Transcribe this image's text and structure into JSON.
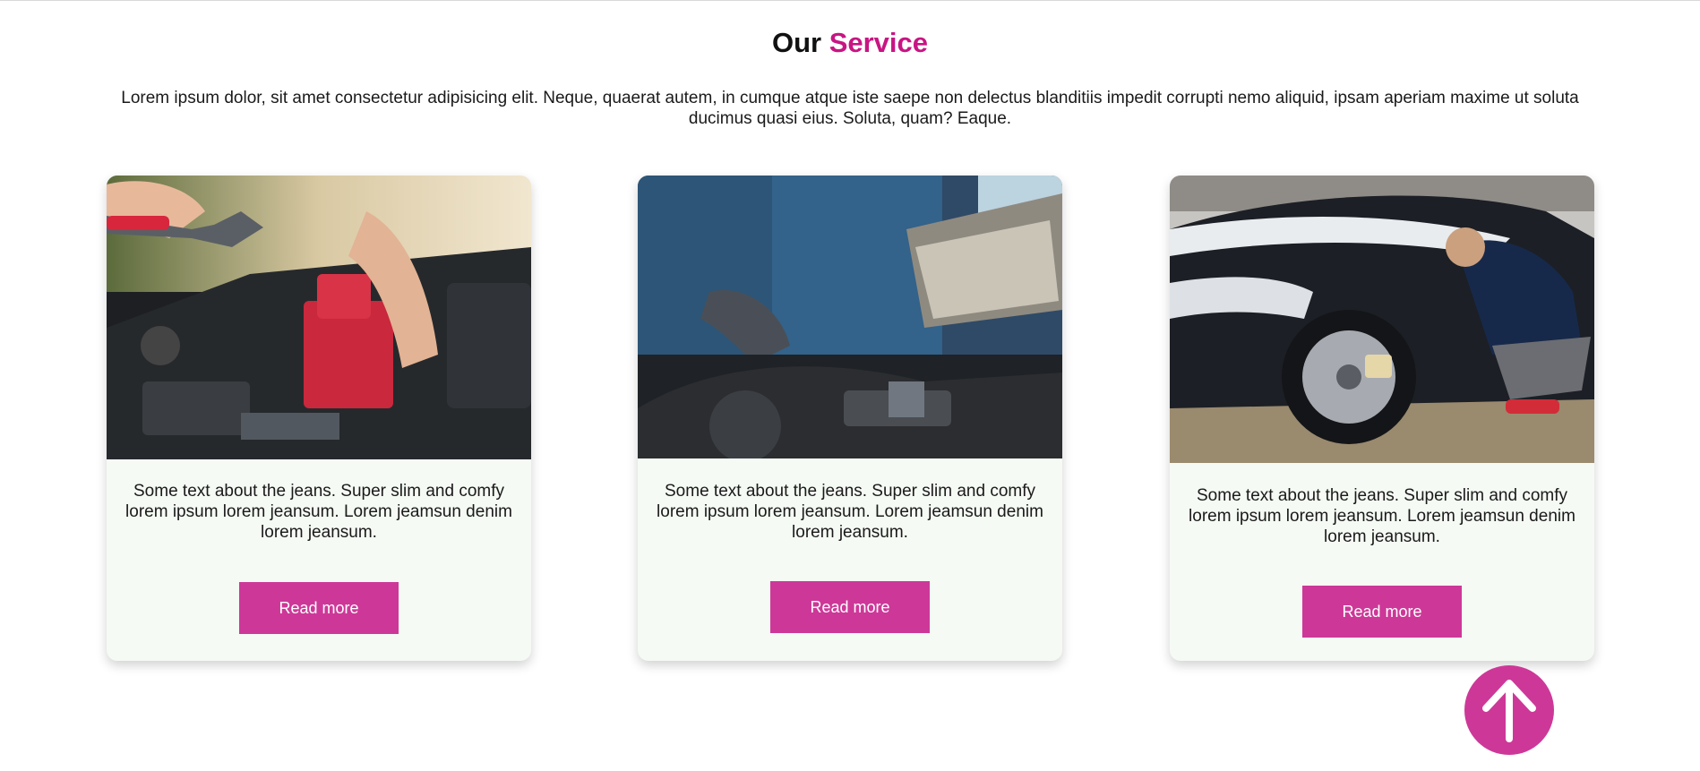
{
  "section": {
    "title_main": "Our",
    "title_accent": "Service",
    "intro": "Lorem ipsum dolor, sit amet consectetur adipisicing elit. Neque, quaerat autem, in cumque atque iste saepe non delectus blanditiis impedit corrupti nemo aliquid, ipsam aperiam maxime ut soluta ducimus quasi eius. Soluta, quam? Eaque."
  },
  "cards": [
    {
      "image": "car-battery-repair-photo",
      "text": "Some text about the jeans. Super slim and comfy lorem ipsum lorem jeansum. Lorem jeamsun denim lorem jeansum.",
      "button_label": "Read more"
    },
    {
      "image": "engine-diagnostics-laptop-photo",
      "text": "Some text about the jeans. Super slim and comfy lorem ipsum lorem jeansum. Lorem jeamsun denim lorem jeansum.",
      "button_label": "Read more"
    },
    {
      "image": "car-wash-photo",
      "text": "Some text about the jeans. Super slim and comfy lorem ipsum lorem jeansum. Lorem jeamsun denim lorem jeansum.",
      "button_label": "Read more"
    }
  ],
  "scroll_top": {
    "icon": "arrow-up-icon"
  },
  "colors": {
    "accent": "#c81583",
    "button": "#cd3898",
    "card_background": "#f5faf4"
  }
}
